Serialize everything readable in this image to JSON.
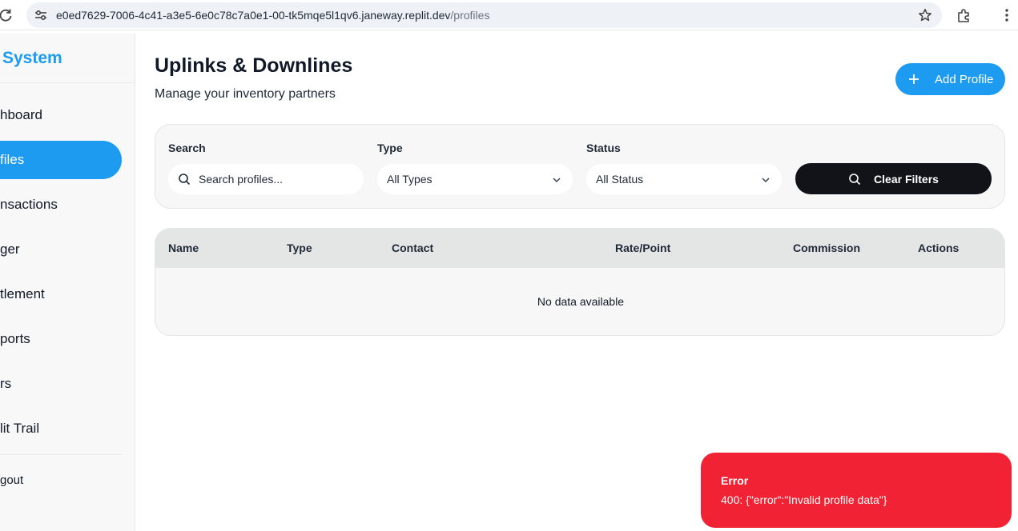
{
  "browser": {
    "url_host": "e0ed7629-7006-4c41-a3e5-6e0c78c7a0e1-00-tk5mqe5l1qv6.janeway.replit.dev",
    "url_path": "/profiles"
  },
  "sidebar": {
    "brand": "System",
    "items": [
      {
        "label": "hboard",
        "active": false
      },
      {
        "label": "files",
        "active": true
      },
      {
        "label": "nsactions",
        "active": false
      },
      {
        "label": "ger",
        "active": false
      },
      {
        "label": "tlement",
        "active": false
      },
      {
        "label": "ports",
        "active": false
      },
      {
        "label": "rs",
        "active": false
      },
      {
        "label": "lit Trail",
        "active": false
      }
    ],
    "logout": "gout"
  },
  "header": {
    "title": "Uplinks & Downlines",
    "subtitle": "Manage your inventory partners",
    "add_button": "Add Profile"
  },
  "filters": {
    "search_label": "Search",
    "search_placeholder": "Search profiles...",
    "type_label": "Type",
    "type_value": "All Types",
    "status_label": "Status",
    "status_value": "All Status",
    "clear_button": "Clear Filters"
  },
  "table": {
    "columns": [
      "Name",
      "Type",
      "Contact",
      "Rate/Point",
      "Commission",
      "Actions"
    ],
    "empty_message": "No data available"
  },
  "toast": {
    "title": "Error",
    "message": "400: {\"error\":\"Invalid profile data\"}"
  },
  "colors": {
    "accent": "#1d9bf0",
    "error": "#f02233",
    "dark_button": "#111318"
  },
  "icons": [
    "reload-icon",
    "site-settings-icon",
    "star-icon",
    "extensions-icon",
    "kebab-menu-icon",
    "plus-icon",
    "search-icon",
    "chevron-down-icon"
  ]
}
